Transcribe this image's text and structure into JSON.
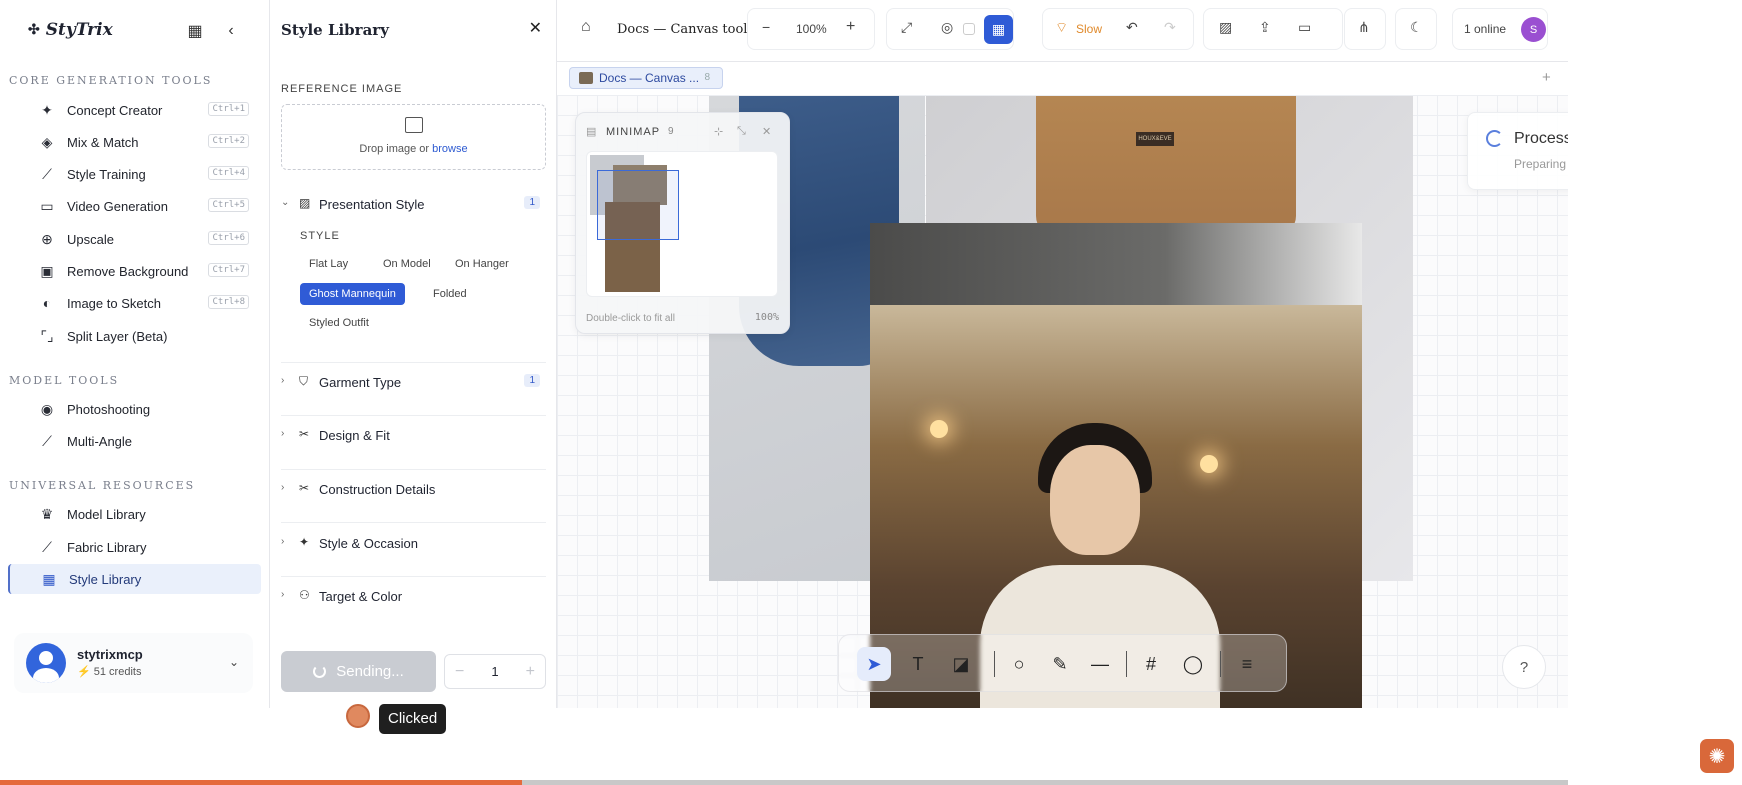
{
  "sidebar": {
    "brand": "StyTrix",
    "sections": [
      {
        "title": "CORE GENERATION TOOLS"
      },
      {
        "title": "MODEL TOOLS"
      },
      {
        "title": "UNIVERSAL RESOURCES"
      }
    ],
    "items": [
      {
        "label": "Concept Creator",
        "shortcut": "Ctrl+1"
      },
      {
        "label": "Mix & Match",
        "shortcut": "Ctrl+2"
      },
      {
        "label": "Style Training",
        "shortcut": "Ctrl+4"
      },
      {
        "label": "Video Generation",
        "shortcut": "Ctrl+5"
      },
      {
        "label": "Upscale",
        "shortcut": "Ctrl+6"
      },
      {
        "label": "Remove Background",
        "shortcut": "Ctrl+7"
      },
      {
        "label": "Image to Sketch",
        "shortcut": "Ctrl+8"
      },
      {
        "label": "Split Layer (Beta)"
      },
      {
        "label": "Photoshooting"
      },
      {
        "label": "Multi-Angle"
      },
      {
        "label": "Model Library"
      },
      {
        "label": "Fabric Library"
      },
      {
        "label": "Style Library"
      }
    ],
    "user": {
      "name": "stytrixmcp",
      "credits": "51 credits"
    }
  },
  "panel": {
    "title": "Style Library",
    "reference_label": "REFERENCE IMAGE",
    "drop_text": "Drop image or",
    "browse_text": "browse",
    "sections": [
      {
        "label": "Presentation Style",
        "count": "1"
      },
      {
        "label": "Garment Type",
        "count": "1"
      },
      {
        "label": "Design & Fit"
      },
      {
        "label": "Construction Details"
      },
      {
        "label": "Style & Occasion"
      },
      {
        "label": "Target & Color"
      }
    ],
    "style_label": "STYLE",
    "chips": [
      "Flat Lay",
      "On Model",
      "On Hanger",
      "Ghost Mannequin",
      "Folded",
      "Styled Outfit"
    ],
    "selected_chip": "Ghost Mannequin",
    "send_label": "Sending...",
    "quantity": "1"
  },
  "toolbar": {
    "doc_title": "Docs — Canvas tools",
    "zoom": "100%",
    "speed": "Slow",
    "online": "1 online",
    "user_initial": "S"
  },
  "doc_tab": {
    "label": "Docs — Canvas ...",
    "count": "8"
  },
  "minimap": {
    "title": "MINIMAP",
    "count": "9",
    "hint": "Double-click to fit all",
    "zoom": "100%"
  },
  "process": {
    "title": "Process",
    "subtitle": "Preparing"
  },
  "overlay": {
    "clicked": "Clicked",
    "progress_fraction": 0.333
  },
  "colors": {
    "accent": "#2f5bd6",
    "brand": "#d9683a",
    "slow": "#e08a2c"
  },
  "icons": [
    "home-icon",
    "zoom-out-icon",
    "zoom-in-icon",
    "fit-icon",
    "palette-icon",
    "grid-icon",
    "undo-icon",
    "redo-icon",
    "image-icon",
    "upload-icon",
    "video-icon",
    "share-icon",
    "moon-icon",
    "select-icon",
    "text-icon",
    "sticky-icon",
    "circle-icon",
    "pen-icon",
    "line-icon",
    "frame-icon",
    "comment-icon",
    "menu-icon",
    "help-icon"
  ]
}
